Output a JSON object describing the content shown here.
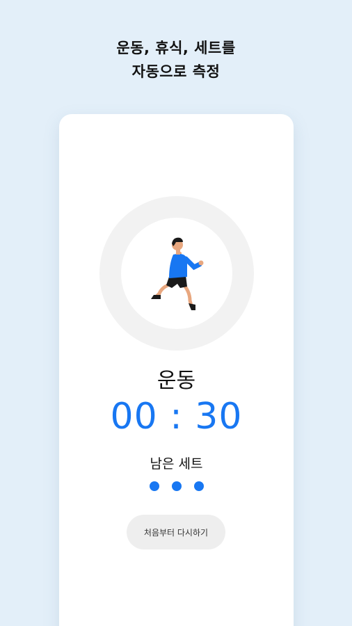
{
  "headline": {
    "line1": "운동, 휴식, 세트를",
    "line2": "자동으로 측정"
  },
  "timer_card": {
    "illustration": "runner-illustration",
    "phase_label": "운동",
    "time": "00 : 30",
    "sets_label": "남은 세트",
    "remaining_sets": 3,
    "restart_label": "처음부터 다시하기"
  },
  "colors": {
    "background": "#e3eff9",
    "accent": "#1877f2",
    "ring": "#f2f2f2",
    "button_bg": "#eeeeee"
  }
}
